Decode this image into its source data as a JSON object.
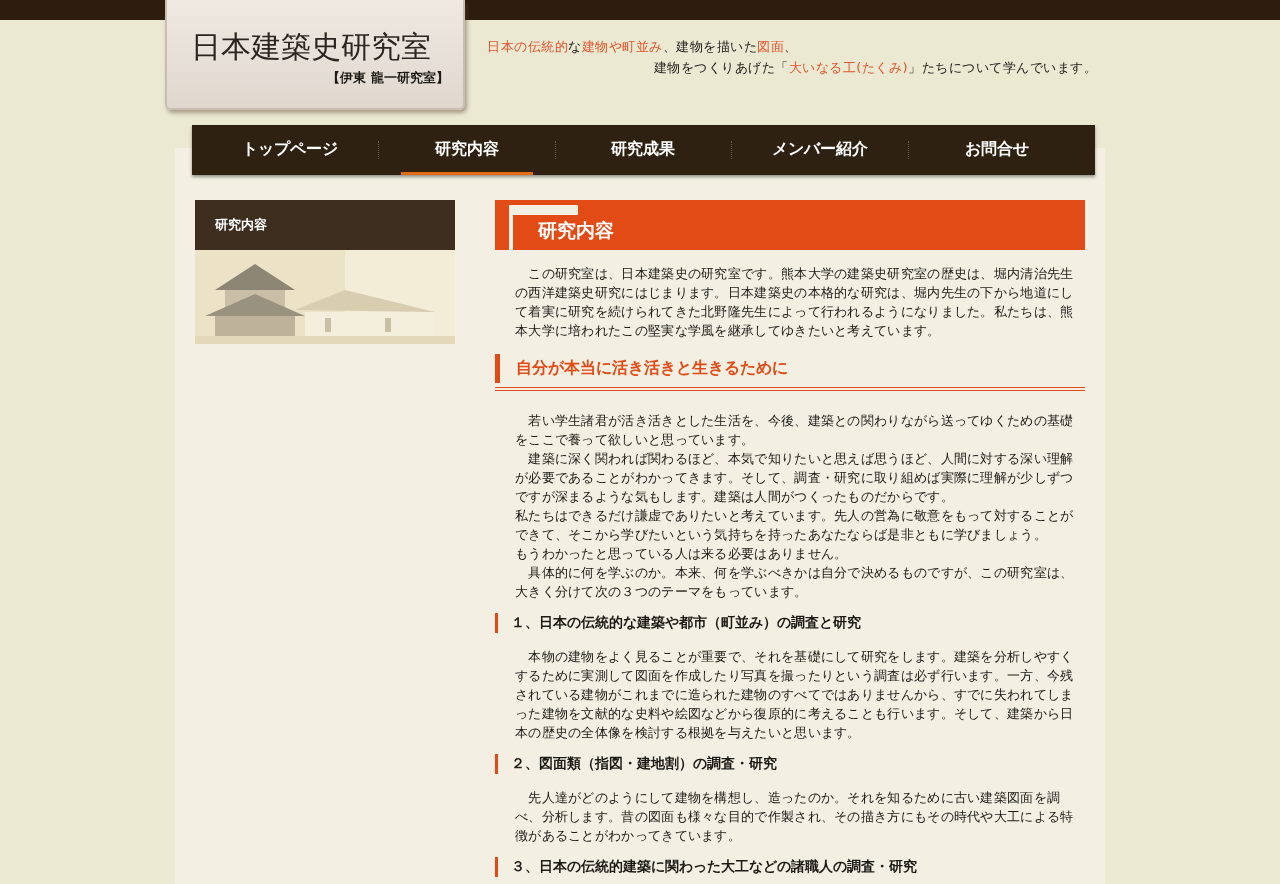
{
  "header": {
    "title": "日本建築史研究室",
    "subtitle": "【伊東 龍一研究室】",
    "tagline": [
      [
        {
          "text": "日本の伝統的",
          "highlight": true
        },
        {
          "text": "な",
          "highlight": false
        },
        {
          "text": "建物や町並み",
          "highlight": true
        },
        {
          "text": "、建物を描いた",
          "highlight": false
        },
        {
          "text": "図面",
          "highlight": true
        },
        {
          "text": "、",
          "highlight": false
        }
      ],
      [
        {
          "text": "建物をつくりあげた「",
          "highlight": false
        },
        {
          "text": "大いなる工(たくみ)",
          "highlight": true
        },
        {
          "text": "」たちについて学んでいます。",
          "highlight": false
        }
      ]
    ]
  },
  "nav": [
    {
      "label": "トップページ",
      "selected": false
    },
    {
      "label": "研究内容",
      "selected": true
    },
    {
      "label": "研究成果",
      "selected": false
    },
    {
      "label": "メンバー紹介",
      "selected": false
    },
    {
      "label": "お問合せ",
      "selected": false
    }
  ],
  "sidebar": {
    "title": "研究内容"
  },
  "content": {
    "title": "研究内容",
    "blocks": [
      {
        "kind": "paragraph",
        "lines": [
          "　この研究室は、日本建築史の研究室です。熊本大学の建築史研究室の歴史は、堀内清治先生の西洋建築史研究にはじまります。日本建築史の本格的な研究は、堀内先生の下から地道にして着実に研究を続けられてきた北野隆先生によって行われるようになりました。私たちは、熊本大学に培われたこの堅実な学風を継承してゆきたいと考えています。"
        ]
      },
      {
        "kind": "heading",
        "text": "自分が本当に活き活きと生きるために"
      },
      {
        "kind": "paragraph",
        "lines": [
          "　若い学生諸君が活き活きとした生活を、今後、建築との関わりながら送ってゆくための基礎をここで養って欲しいと思っています。",
          "　建築に深く関われば関わるほど、本気で知りたいと思えば思うほど、人間に対する深い理解が必要であることがわかってきます。そして、調査・研究に取り組めば実際に理解が少しずつですが深まるような気もします。建築は人間がつくったものだからです。",
          "私たちはできるだけ謙虚でありたいと考えています。先人の営為に敬意をもって対することができて、そこから学びたいという気持ちを持ったあなたならば是非ともに学びましょう。",
          "もうわかったと思っている人は来る必要はありません。",
          "　具体的に何を学ぶのか。本来、何を学ぶべきかは自分で決めるものですが、この研究室は、大きく分けて次の３つのテーマをもっています。"
        ]
      },
      {
        "kind": "subheading",
        "text": "１、日本の伝統的な建築や都市（町並み）の調査と研究"
      },
      {
        "kind": "paragraph",
        "lines": [
          "　本物の建物をよく見ることが重要で、それを基礎にして研究をします。建築を分析しやすくするために実測して図面を作成したり写真を撮ったりという調査は必ず行います。一方、今残されている建物がこれまでに造られた建物のすべてではありませんから、すでに失われてしまった建物を文献的な史料や絵図などから復原的に考えることも行います。そして、建築から日本の歴史の全体像を検討する根拠を与えたいと思います。"
        ]
      },
      {
        "kind": "subheading",
        "text": "２、図面類（指図・建地割）の調査・研究"
      },
      {
        "kind": "paragraph",
        "lines": [
          "　先人達がどのようにして建物を構想し、造ったのか。それを知るために古い建築図面を調べ、分析します。昔の図面も様々な目的で作製され、その描き方にもその時代や大工による特徴があることがわかってきています。"
        ]
      },
      {
        "kind": "subheading",
        "text": "３、日本の伝統的建築に関わった大工などの諸職人の調査・研究"
      }
    ]
  }
}
